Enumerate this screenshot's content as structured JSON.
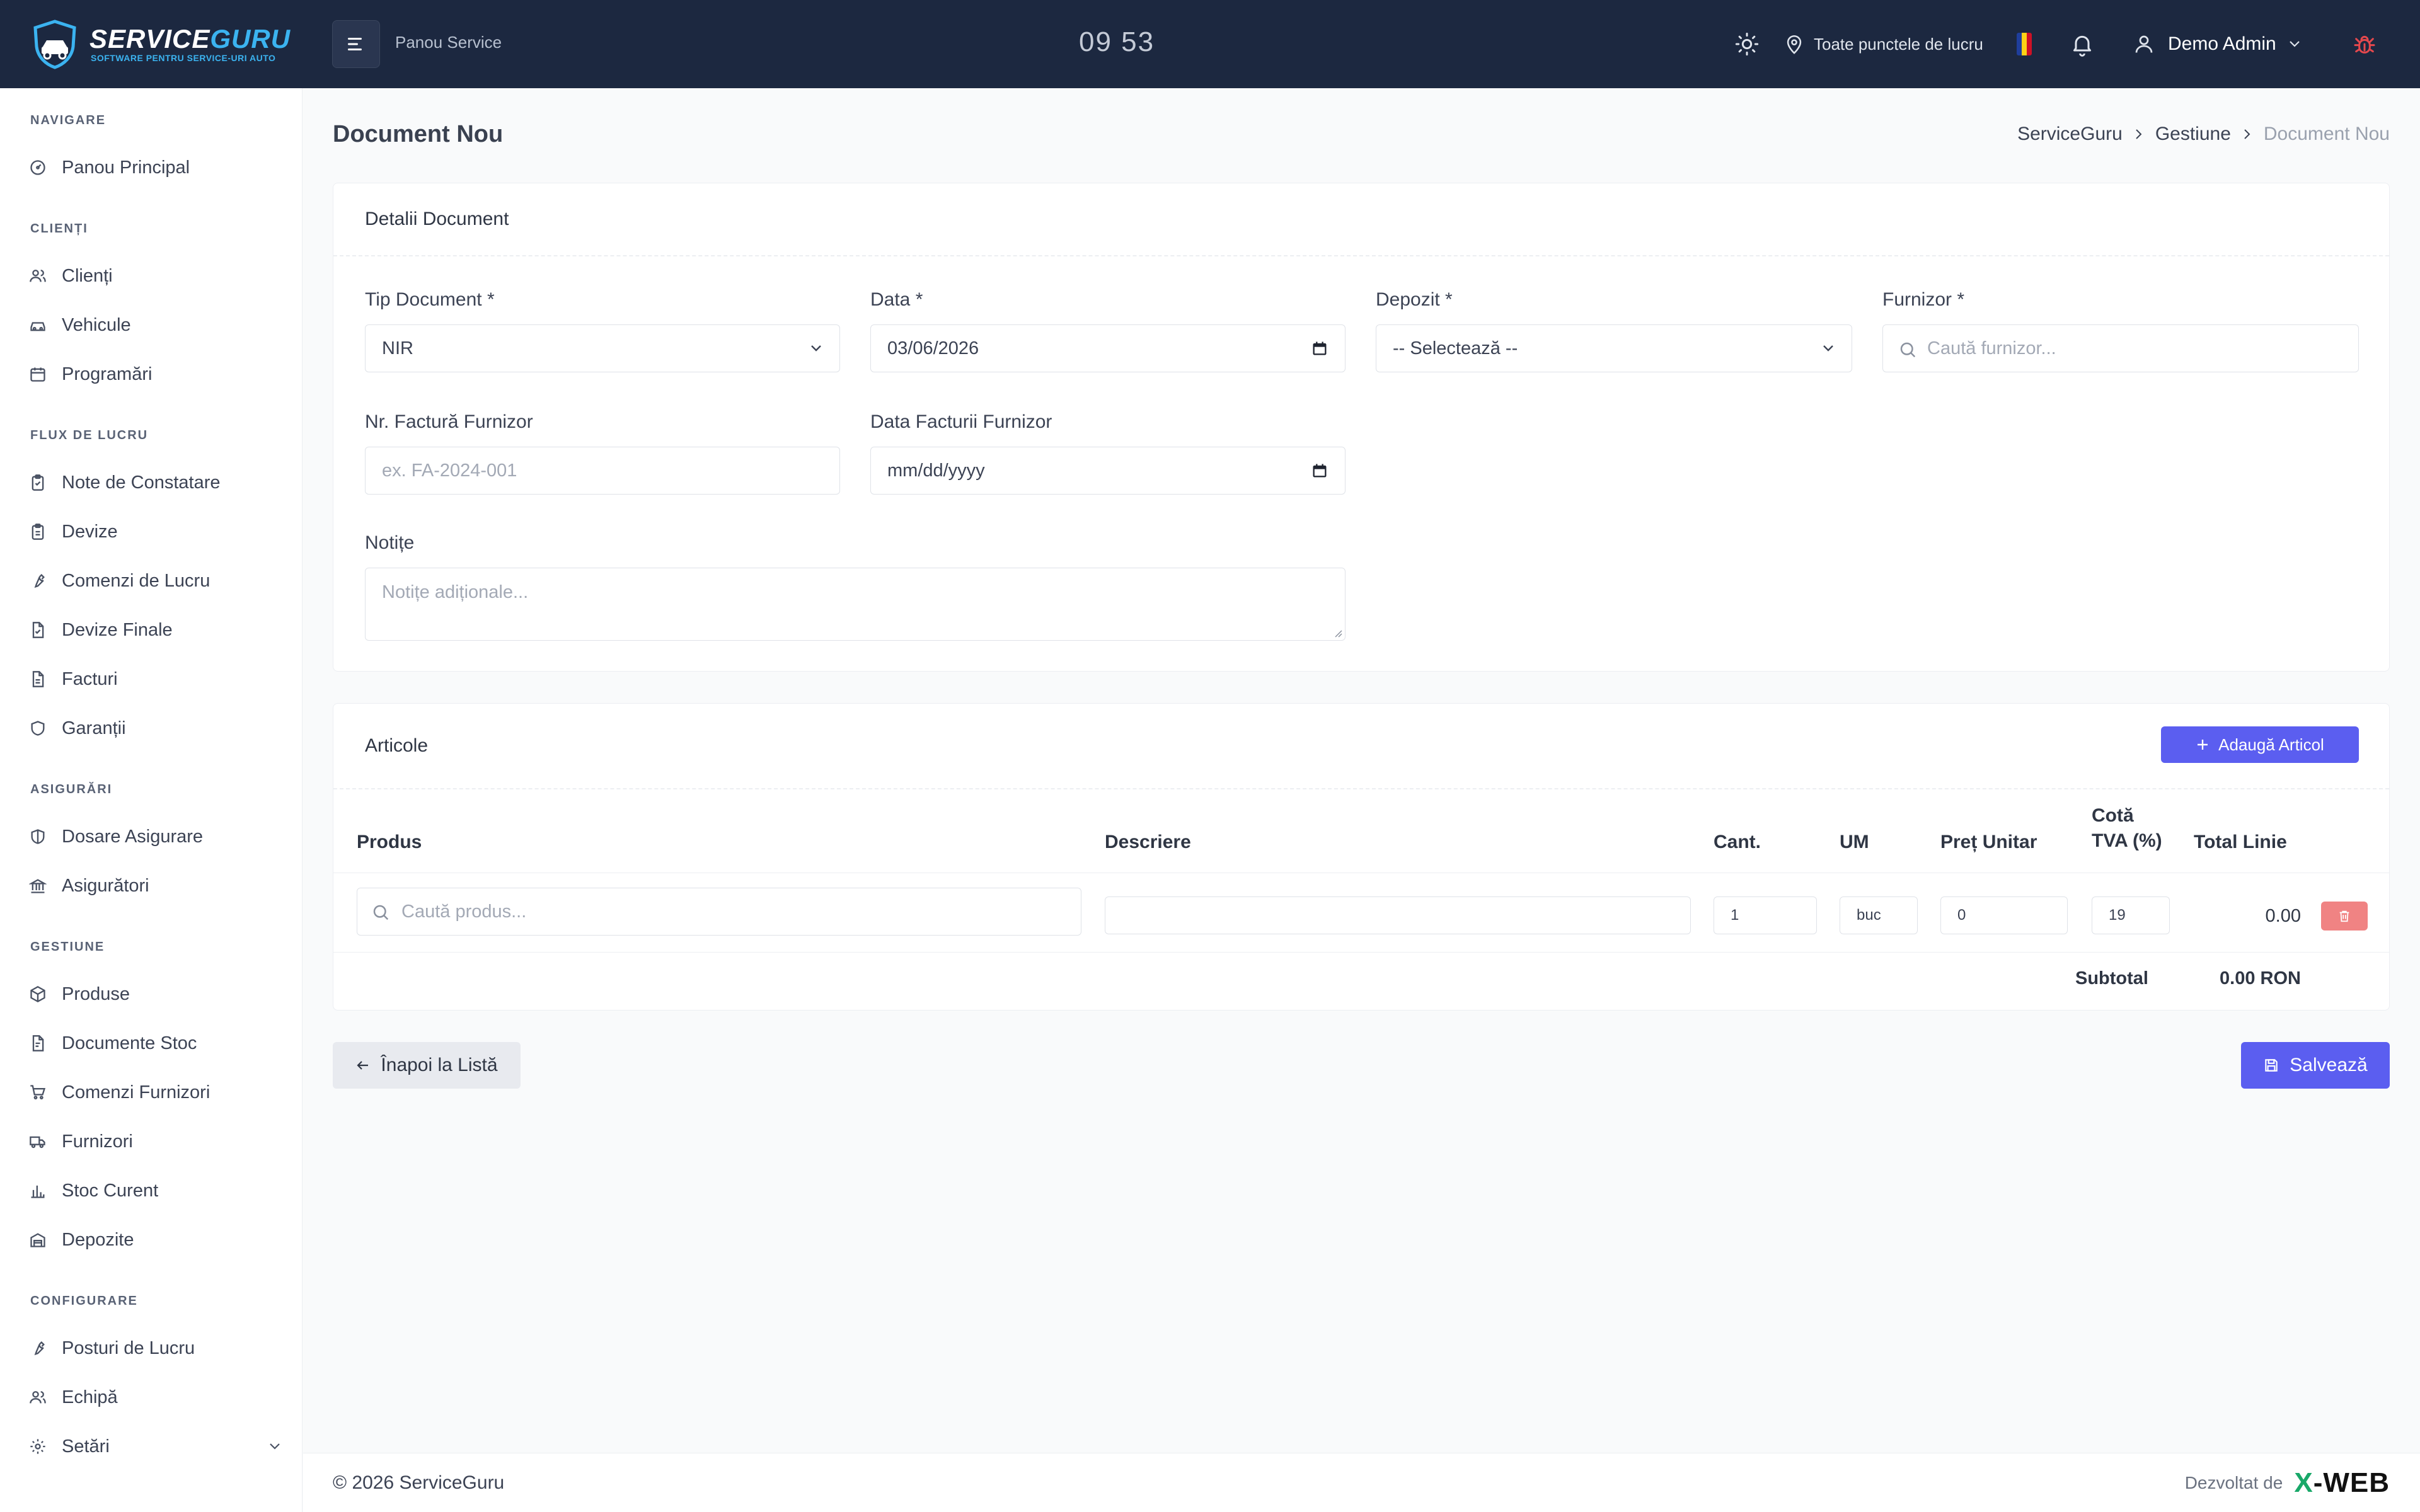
{
  "header": {
    "logo_title_a": "SERVICE",
    "logo_title_b": "GURU",
    "logo_subtitle": "SOFTWARE PENTRU SERVICE-URI AUTO",
    "panel_label": "Panou Service",
    "clock": "09 53",
    "location": "Toate punctele de lucru",
    "user_name": "Demo Admin",
    "flag_colors": [
      "#1f3e9c",
      "#fcd116",
      "#ce1126"
    ]
  },
  "sidebar": {
    "sections": [
      {
        "title": "NAVIGARE",
        "items": [
          {
            "label": "Panou Principal",
            "icon": "dashboard-icon"
          }
        ]
      },
      {
        "title": "CLIENȚI",
        "items": [
          {
            "label": "Clienți",
            "icon": "users-icon"
          },
          {
            "label": "Vehicule",
            "icon": "car-icon"
          },
          {
            "label": "Programări",
            "icon": "calendar-icon"
          }
        ]
      },
      {
        "title": "FLUX DE LUCRU",
        "items": [
          {
            "label": "Note de Constatare",
            "icon": "clipboard-check-icon"
          },
          {
            "label": "Devize",
            "icon": "clipboard-icon"
          },
          {
            "label": "Comenzi de Lucru",
            "icon": "wrench-icon"
          },
          {
            "label": "Devize Finale",
            "icon": "file-check-icon"
          },
          {
            "label": "Facturi",
            "icon": "file-text-icon"
          },
          {
            "label": "Garanții",
            "icon": "shield-icon"
          }
        ]
      },
      {
        "title": "ASIGURĂRI",
        "items": [
          {
            "label": "Dosare Asigurare",
            "icon": "shield-half-icon"
          },
          {
            "label": "Asigurători",
            "icon": "bank-icon"
          }
        ]
      },
      {
        "title": "GESTIUNE",
        "items": [
          {
            "label": "Produse",
            "icon": "box-icon"
          },
          {
            "label": "Documente Stoc",
            "icon": "file-icon"
          },
          {
            "label": "Comenzi Furnizori",
            "icon": "cart-icon"
          },
          {
            "label": "Furnizori",
            "icon": "truck-icon"
          },
          {
            "label": "Stoc Curent",
            "icon": "bar-chart-icon"
          },
          {
            "label": "Depozite",
            "icon": "warehouse-icon"
          }
        ]
      },
      {
        "title": "CONFIGURARE",
        "items": [
          {
            "label": "Posturi de Lucru",
            "icon": "wrench-icon"
          },
          {
            "label": "Echipă",
            "icon": "team-icon"
          },
          {
            "label": "Setări",
            "icon": "gear-icon"
          }
        ]
      }
    ]
  },
  "page": {
    "title": "Document Nou",
    "breadcrumb": [
      "ServiceGuru",
      "Gestiune",
      "Document Nou"
    ]
  },
  "details": {
    "card_title": "Detalii Document",
    "tip_label": "Tip Document *",
    "tip_value": "NIR",
    "data_label": "Data *",
    "data_value": "03/06/2026",
    "depozit_label": "Depozit *",
    "depozit_value": "-- Selectează --",
    "furnizor_label": "Furnizor *",
    "furnizor_placeholder": "Caută furnizor...",
    "nr_factura_label": "Nr. Factură Furnizor",
    "nr_factura_placeholder": "ex. FA-2024-001",
    "data_factura_label": "Data Facturii Furnizor",
    "data_factura_value": "mm/dd/yyyy",
    "notite_label": "Notițe",
    "notite_placeholder": "Notițe adiționale..."
  },
  "articles": {
    "card_title": "Articole",
    "add_button": "Adaugă Articol",
    "columns": {
      "produs": "Produs",
      "descriere": "Descriere",
      "cant": "Cant.",
      "um": "UM",
      "pret": "Preț Unitar",
      "cota_1": "Cotă",
      "cota_2": "TVA (%)",
      "total": "Total Linie"
    },
    "row": {
      "produs_placeholder": "Caută produs...",
      "descriere": "",
      "cant": "1",
      "um": "buc",
      "pret": "0",
      "tva": "19",
      "total": "0.00"
    },
    "subtotal_label": "Subtotal",
    "subtotal_value": "0.00 RON"
  },
  "actions": {
    "back": "Înapoi la Listă",
    "save": "Salvează"
  },
  "footer": {
    "copyright": "© 2026 ServiceGuru",
    "developed_by": "Dezvoltat de",
    "brand_x": "X",
    "brand_rest": "-WEB"
  }
}
